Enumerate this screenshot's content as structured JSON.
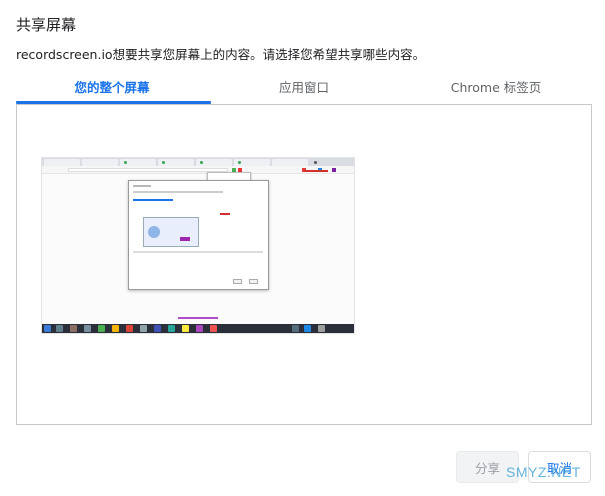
{
  "dialog": {
    "title": "共享屏幕",
    "subtitle": "recordscreen.io想要共享您屏幕上的内容。请选择您希望共享哪些内容。"
  },
  "tabs": [
    {
      "label": "您的整个屏幕",
      "active": true
    },
    {
      "label": "应用窗口",
      "active": false
    },
    {
      "label": "Chrome 标签页",
      "active": false
    }
  ],
  "buttons": {
    "share_label": "分享",
    "cancel_label": "取消"
  },
  "watermark": "SMYZ.NET",
  "colors": {
    "accent": "#1a73e8",
    "border": "#c8c8c8",
    "disabled_text": "#9aa0a6"
  }
}
